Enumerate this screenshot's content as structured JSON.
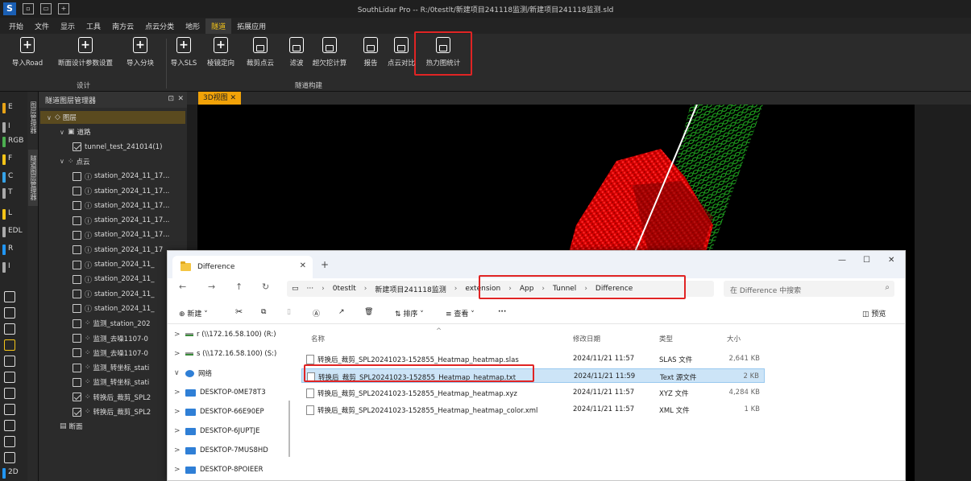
{
  "app": {
    "title": "SouthLidar Pro -- R:/0testlt/新建项目241118监测/新建项目241118监测.sld",
    "logo": "S"
  },
  "menu": [
    "开始",
    "文件",
    "显示",
    "工具",
    "南方云",
    "点云分类",
    "地形",
    "隧道",
    "拓展应用"
  ],
  "active_menu": "隧道",
  "ribbon": {
    "buttons": [
      {
        "label": "导入Road",
        "icon": "plus-doc-icon"
      },
      {
        "label": "断面设计参数设置",
        "icon": "plus-doc-icon"
      },
      {
        "label": "导入分块",
        "icon": "plus-doc-icon"
      },
      {
        "label": "导入SLS",
        "icon": "plus-doc-icon"
      },
      {
        "label": "棱镜定向",
        "icon": "plus-doc-icon"
      },
      {
        "label": "裁剪点云",
        "icon": "doc-icon"
      },
      {
        "label": "滤波",
        "icon": "doc-icon"
      },
      {
        "label": "超欠挖计算",
        "icon": "doc-icon"
      },
      {
        "label": "报告",
        "icon": "doc-icon"
      },
      {
        "label": "点云对比",
        "icon": "doc-icon"
      },
      {
        "label": "热力图统计",
        "icon": "doc-icon"
      }
    ],
    "groups": [
      "设计",
      "隧道构建"
    ]
  },
  "strip": {
    "items": [
      "E",
      "I",
      "RGB",
      "F",
      "C",
      "T",
      "L",
      "EDL",
      "R",
      "I",
      "2D"
    ]
  },
  "side_tabs": [
    "图层管理器",
    "隧道图层管理器"
  ],
  "layer_panel": {
    "title": "隧道图层管理器",
    "pin": "⊡",
    "close": "✕",
    "tree": [
      {
        "level": 0,
        "label": "图层",
        "checkbox": "none",
        "icon": "layers-icon",
        "expanded": true
      },
      {
        "level": 1,
        "label": "道路",
        "checkbox": "none",
        "icon": "road-icon",
        "expanded": true
      },
      {
        "level": 2,
        "label": "tunnel_test_241014(1)",
        "checkbox": "on",
        "icon": ""
      },
      {
        "level": 1,
        "label": "点云",
        "checkbox": "none",
        "icon": "pointcloud-icon",
        "expanded": true
      },
      {
        "level": 2,
        "label": "station_2024_11_17...",
        "checkbox": "off",
        "icon": "info-icon"
      },
      {
        "level": 2,
        "label": "station_2024_11_17...",
        "checkbox": "off",
        "icon": "info-icon"
      },
      {
        "level": 2,
        "label": "station_2024_11_17...",
        "checkbox": "off",
        "icon": "info-icon"
      },
      {
        "level": 2,
        "label": "station_2024_11_17...",
        "checkbox": "off",
        "icon": "info-icon"
      },
      {
        "level": 2,
        "label": "station_2024_11_17...",
        "checkbox": "off",
        "icon": "info-icon"
      },
      {
        "level": 2,
        "label": "station_2024_11_17",
        "checkbox": "off",
        "icon": "info-icon"
      },
      {
        "level": 2,
        "label": "station_2024_11_",
        "checkbox": "off",
        "icon": "info-icon"
      },
      {
        "level": 2,
        "label": "station_2024_11_",
        "checkbox": "off",
        "icon": "info-icon"
      },
      {
        "level": 2,
        "label": "station_2024_11_",
        "checkbox": "off",
        "icon": "info-icon"
      },
      {
        "level": 2,
        "label": "station_2024_11_",
        "checkbox": "off",
        "icon": "info-icon"
      },
      {
        "level": 2,
        "label": "监测_station_202",
        "checkbox": "off",
        "icon": "pointcloud-icon"
      },
      {
        "level": 2,
        "label": "监测_去噪1107-0",
        "checkbox": "off",
        "icon": "pointcloud-icon"
      },
      {
        "level": 2,
        "label": "监测_去噪1107-0",
        "checkbox": "off",
        "icon": "pointcloud-icon"
      },
      {
        "level": 2,
        "label": "监测_转坐标_stati",
        "checkbox": "off",
        "icon": "pointcloud-icon"
      },
      {
        "level": 2,
        "label": "监测_转坐标_stati",
        "checkbox": "off",
        "icon": "pointcloud-icon"
      },
      {
        "level": 2,
        "label": "转换后_裁剪_SPL2",
        "checkbox": "on",
        "icon": "pointcloud-icon"
      },
      {
        "level": 2,
        "label": "转换后_裁剪_SPL2",
        "checkbox": "on",
        "icon": "pointcloud-icon"
      },
      {
        "level": 1,
        "label": "断面",
        "checkbox": "none",
        "icon": "section-icon"
      }
    ]
  },
  "viewport": {
    "tab_label": "3D视图 ✕"
  },
  "explorer": {
    "tab_title": "Difference",
    "tab_close": "✕",
    "new_tab": "+",
    "window_controls": [
      "—",
      "☐",
      "✕"
    ],
    "nav": {
      "back": "←",
      "forward": "→",
      "up": "↑",
      "refresh": "↻"
    },
    "breadcrumbs": [
      "···",
      "0testlt",
      "新建项目241118监测",
      "extension",
      "App",
      "Tunnel",
      "Difference"
    ],
    "search_placeholder": "在 Difference 中搜索",
    "toolbar": {
      "new": "新建",
      "sort": "排序",
      "view": "查看",
      "more": "···",
      "preview": "预览"
    },
    "sidebar": [
      {
        "label": "r (\\\\172.16.58.100) (R:)",
        "icon": "drive-icon",
        "chevron": ">"
      },
      {
        "label": "s (\\\\172.16.58.100) (S:)",
        "icon": "drive-icon",
        "chevron": ">"
      },
      {
        "label": "网络",
        "icon": "network-icon",
        "chevron": "∨"
      },
      {
        "label": "DESKTOP-0ME78T3",
        "icon": "computer-icon",
        "chevron": ">"
      },
      {
        "label": "DESKTOP-66E90EP",
        "icon": "computer-icon",
        "chevron": ">"
      },
      {
        "label": "DESKTOP-6JUPTJE",
        "icon": "computer-icon",
        "chevron": ">"
      },
      {
        "label": "DESKTOP-7MUS8HD",
        "icon": "computer-icon",
        "chevron": ">"
      },
      {
        "label": "DESKTOP-8POIEER",
        "icon": "computer-icon",
        "chevron": ">"
      }
    ],
    "columns": [
      "名称",
      "修改日期",
      "类型",
      "大小"
    ],
    "files": [
      {
        "name": "转换后_裁剪_SPL20241023-152855_Heatmap_heatmap.slas",
        "date": "2024/11/21 11:57",
        "type": "SLAS 文件",
        "size": "2,641 KB",
        "selected": false
      },
      {
        "name": "转换后_裁剪_SPL20241023-152855_Heatmap_heatmap.txt",
        "date": "2024/11/21 11:59",
        "type": "Text 源文件",
        "size": "2 KB",
        "selected": true
      },
      {
        "name": "转换后_裁剪_SPL20241023-152855_Heatmap_heatmap.xyz",
        "date": "2024/11/21 11:57",
        "type": "XYZ 文件",
        "size": "4,284 KB",
        "selected": false
      },
      {
        "name": "转换后_裁剪_SPL20241023-152855_Heatmap_heatmap_color.xml",
        "date": "2024/11/21 11:57",
        "type": "XML 文件",
        "size": "1 KB",
        "selected": false
      }
    ]
  },
  "colors": {
    "accent": "#f5c518",
    "highlight": "#e02424",
    "selection": "#cce4f7",
    "cloud": "#ff0000",
    "cloud_green": "#1fbf1f"
  }
}
